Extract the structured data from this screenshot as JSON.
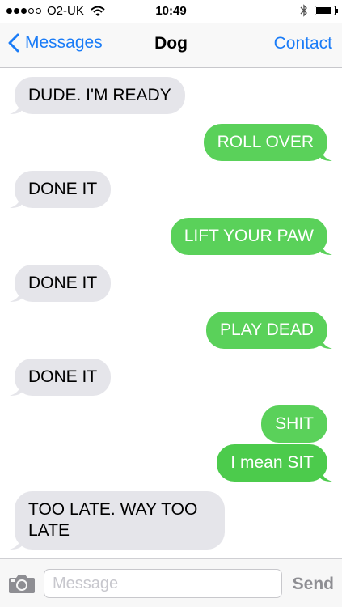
{
  "status_bar": {
    "carrier": "O2-UK",
    "time": "10:49",
    "signal_bars_filled": 3,
    "signal_bars_total": 5,
    "battery_level": 0.85
  },
  "nav": {
    "back_label": "Messages",
    "title": "Dog",
    "contact_label": "Contact"
  },
  "messages": [
    {
      "from": "received",
      "text": "DUDE. I'M READY"
    },
    {
      "from": "sent",
      "text": "ROLL OVER"
    },
    {
      "from": "received",
      "text": "DONE IT"
    },
    {
      "from": "sent",
      "text": "LIFT YOUR PAW"
    },
    {
      "from": "received",
      "text": "DONE IT"
    },
    {
      "from": "sent",
      "text": "PLAY DEAD"
    },
    {
      "from": "received",
      "text": "DONE IT"
    },
    {
      "from": "sent",
      "text": "SHIT"
    },
    {
      "from": "sent",
      "text": "I mean SIT"
    },
    {
      "from": "received",
      "text": "TOO LATE. WAY TOO LATE"
    }
  ],
  "input_bar": {
    "placeholder": "Message",
    "value": "",
    "send_label": "Send",
    "camera_icon": "camera-icon"
  },
  "colors": {
    "accent": "#1a7cf7",
    "sent_bubble": "#5ad15a",
    "received_bubble": "#e5e5ea"
  }
}
